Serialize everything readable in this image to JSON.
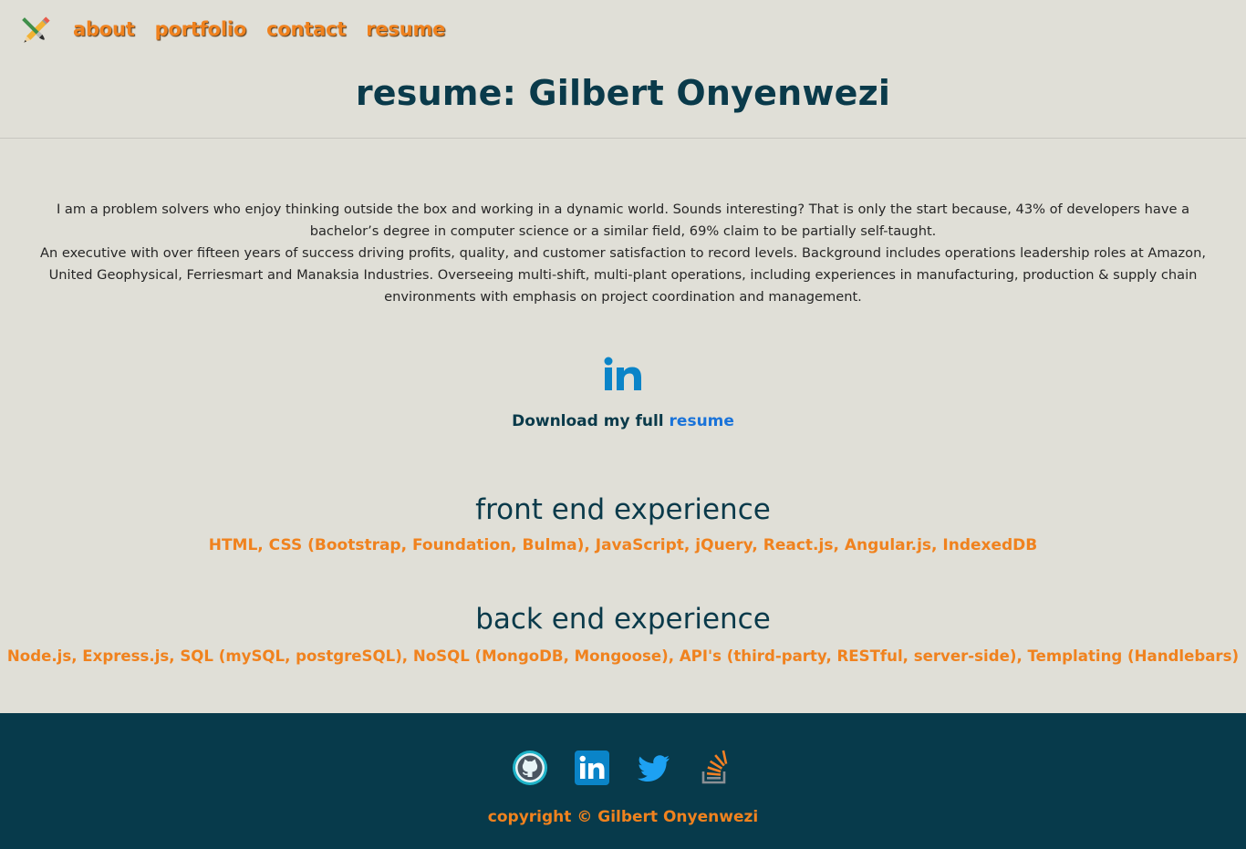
{
  "nav": {
    "items": [
      {
        "label": "about"
      },
      {
        "label": "portfolio"
      },
      {
        "label": "contact"
      },
      {
        "label": "resume"
      }
    ]
  },
  "page": {
    "title": "resume: Gilbert Onyenwezi"
  },
  "bio": {
    "paragraph1": "I am a problem solvers who enjoy thinking outside the box and working in a dynamic world. Sounds interesting? That is only the start because, 43% of developers have a bachelor’s degree in computer science or a similar field, 69% claim to be partially self-taught.",
    "paragraph2": "An executive with over fifteen years of success driving profits, quality, and customer satisfaction to record levels. Background includes operations leadership roles at Amazon, United Geophysical, Ferriesmart and Manaksia Industries. Overseeing multi-shift, multi-plant operations, including experiences in manufacturing, production & supply chain environments with emphasis on project coordination and management."
  },
  "download": {
    "prefix": "Download my full",
    "link_label": "resume"
  },
  "front_end": {
    "heading": "front end experience",
    "skills": "HTML, CSS (Bootstrap, Foundation, Bulma), JavaScript, jQuery, React.js, Angular.js, IndexedDB"
  },
  "back_end": {
    "heading": "back end experience",
    "skills": "Node.js, Express.js, SQL (mySQL, postgreSQL), NoSQL (MongoDB, Mongoose), API's (third-party, RESTful, server-side), Templating (Handlebars)"
  },
  "footer": {
    "icons": [
      "github-icon",
      "linkedin-icon",
      "twitter-icon",
      "stackoverflow-icon"
    ],
    "copyright": "copyright © Gilbert Onyenwezi"
  },
  "colors": {
    "background": "#e0dfd7",
    "accent": "#f0821e",
    "heading": "#0a3a4a",
    "footer": "#073a4b",
    "link": "#1a73d9",
    "linkedin": "#0a84c8"
  }
}
